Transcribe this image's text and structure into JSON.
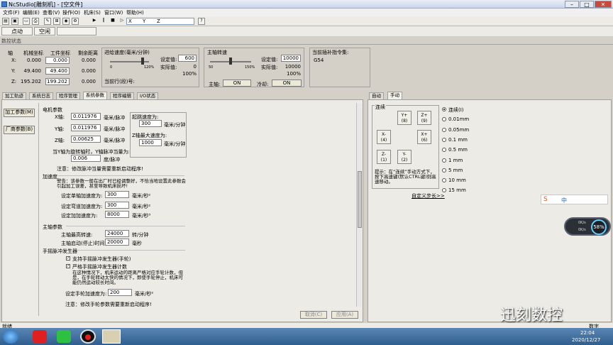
{
  "window": {
    "title": "NcStudio[雕刻机] - [空文件]",
    "min": "–",
    "max": "□",
    "close": "✕"
  },
  "menu": [
    "文件(F)",
    "编辑(E)",
    "查看(V)",
    "操作(O)",
    "机床(S)",
    "窗口(W)",
    "帮助(H)"
  ],
  "toolbar": {
    "coord_x": "X",
    "coord_y": "Y",
    "coord_z": "Z",
    "help": "?"
  },
  "modes": {
    "jog": "点动",
    "rapid": "空闲"
  },
  "status_title": "数控状态",
  "axes": {
    "headers": {
      "axis": "轴",
      "machine": "机械坐标",
      "work": "工件坐标",
      "remain": "剩余距离"
    },
    "rows": [
      {
        "axis": "X:",
        "machine": "0.000",
        "work": "0.000",
        "remain": "0.000"
      },
      {
        "axis": "Y:",
        "machine": "49.400",
        "work": "49.400",
        "remain": "0.000"
      },
      {
        "axis": "Z:",
        "machine": "195.202",
        "work": "199.202",
        "remain": "0.000"
      }
    ]
  },
  "feed": {
    "title": "进给速度(毫米/分钟)",
    "set_label": "设定值:",
    "set_value": "600",
    "actual_label": "实际值:",
    "actual_value": "0",
    "percent": "100%",
    "scale_min": "0",
    "scale_max": "120%",
    "current_line": "当前行(段)号:",
    "slider_level": 1.0
  },
  "spindle": {
    "title": "主轴转速",
    "set_label": "设定值:",
    "set_value": "10000",
    "actual_label": "实际值:",
    "actual_value": "10000",
    "percent": "100%",
    "scale_min": "50",
    "scale_max": "150%",
    "on_label": "主轴:",
    "on_btn": "ON",
    "cool_label": "冷却:",
    "cool_btn": "ON",
    "slider_level": 1.0
  },
  "gcode": {
    "title": "当前插补指令集:",
    "value": "G54"
  },
  "tabs_left": [
    "加工轨迹",
    "系统日志",
    "程序管理",
    "系统参数",
    "程序编辑",
    "I/O状态"
  ],
  "tabs_right": [
    "自动",
    "手动"
  ],
  "side_buttons": {
    "process": "加工参数(M)",
    "factory": "厂商参数(B)"
  },
  "params": {
    "motor_title": "电机参数",
    "x_label": "X轴:",
    "x_value": "0.011976",
    "x_unit": "毫米/脉冲",
    "y_label": "Y轴:",
    "y_value": "0.011976",
    "y_unit": "毫米/脉冲",
    "z_label": "Z轴:",
    "z_value": "0.00625",
    "z_unit": "毫米/脉冲",
    "ratio_label": "当Y轴为旋转轴时，Y轴脉冲当量为:",
    "ratio_value": "0.006",
    "ratio_unit": "度/脉冲",
    "start_speed_label": "起跳速度为:",
    "start_speed_value": "300",
    "start_speed_unit": "毫米/分钟",
    "zmax_label": "Z轴最大速度为:",
    "zmax_value": "1000",
    "zmax_unit": "毫米/分钟",
    "note1": "注意：修改脉冲当量需要重新启动程序!",
    "accel_title": "加速度",
    "warning": "警告：该参数一般在出厂时已经调整好，不恰当地设置此参数会引起加工误差，甚至导致机床损坏!",
    "single_label": "设定单轴加速度为:",
    "single_value": "300",
    "single_unit": "毫米/秒²",
    "curve_label": "设定弯道加速度为:",
    "curve_value": "300",
    "curve_unit": "毫米/秒²",
    "jerk_label": "设定加加速度为:",
    "jerk_value": "8000",
    "jerk_unit": "毫米/秒³",
    "spindle_title": "主轴参数",
    "max_speed_label": "主轴最高转速:",
    "max_speed_value": "24000",
    "max_speed_unit": "转/分钟",
    "delay_label": "主轴启动(停止)时间:",
    "delay_value": "20000",
    "delay_unit": "毫秒",
    "hand_title": "手摇脉冲发生器",
    "support_label": "支持手摇脉冲发生器(手轮)",
    "strict_label": "严格手摇脉冲发生器计数",
    "hand_desc": "在这种情况下，机床运动的距离严格对应手轮计数，但是，在手轮转动太快的情况下，即使手轮停止，机床可能仍然运动较长时间。",
    "hand_accel_label": "设定手轮加速度为:",
    "hand_accel_value": "200",
    "hand_accel_unit": "毫米/秒²",
    "note2": "注意：修改手轮参数需要重新启动程序!",
    "cancel_btn": "取消(C)",
    "apply_btn": "应用(A)"
  },
  "manual": {
    "continuous_title": "连续",
    "jog_buttons": [
      {
        "axis": "Y+",
        "key": "(8)"
      },
      {
        "axis": "Z+",
        "key": "(9)"
      },
      {
        "axis": "X-",
        "key": "(4)"
      },
      {
        "axis": "X+",
        "key": "(6)"
      },
      {
        "axis": "Z-",
        "key": "(1)"
      },
      {
        "axis": "Y-",
        "key": "(2)"
      }
    ],
    "hint": "提示：在“连续”手动方式下，按下高速键(默认CTRL键)则高速移动。",
    "custom_step": "自定义步长>>",
    "steps": [
      {
        "label": "连续(I)",
        "on": true
      },
      {
        "label": "0.01mm",
        "on": false
      },
      {
        "label": "0.05mm",
        "on": false
      },
      {
        "label": "0.1 mm",
        "on": false
      },
      {
        "label": "0.5 mm",
        "on": false
      },
      {
        "label": "1   mm",
        "on": false
      },
      {
        "label": "5   mm",
        "on": false
      },
      {
        "label": "10  mm",
        "on": false
      },
      {
        "label": "15  mm",
        "on": false
      }
    ]
  },
  "status_bar": {
    "left": "就绪",
    "right": "数字"
  },
  "widget": {
    "net_up": "0K/s",
    "net_down": "0K/s",
    "percent": "58%"
  },
  "watermark": "迅刻数控",
  "clock": {
    "time": "22:04",
    "date": "2020/12/27"
  },
  "ime": "中"
}
